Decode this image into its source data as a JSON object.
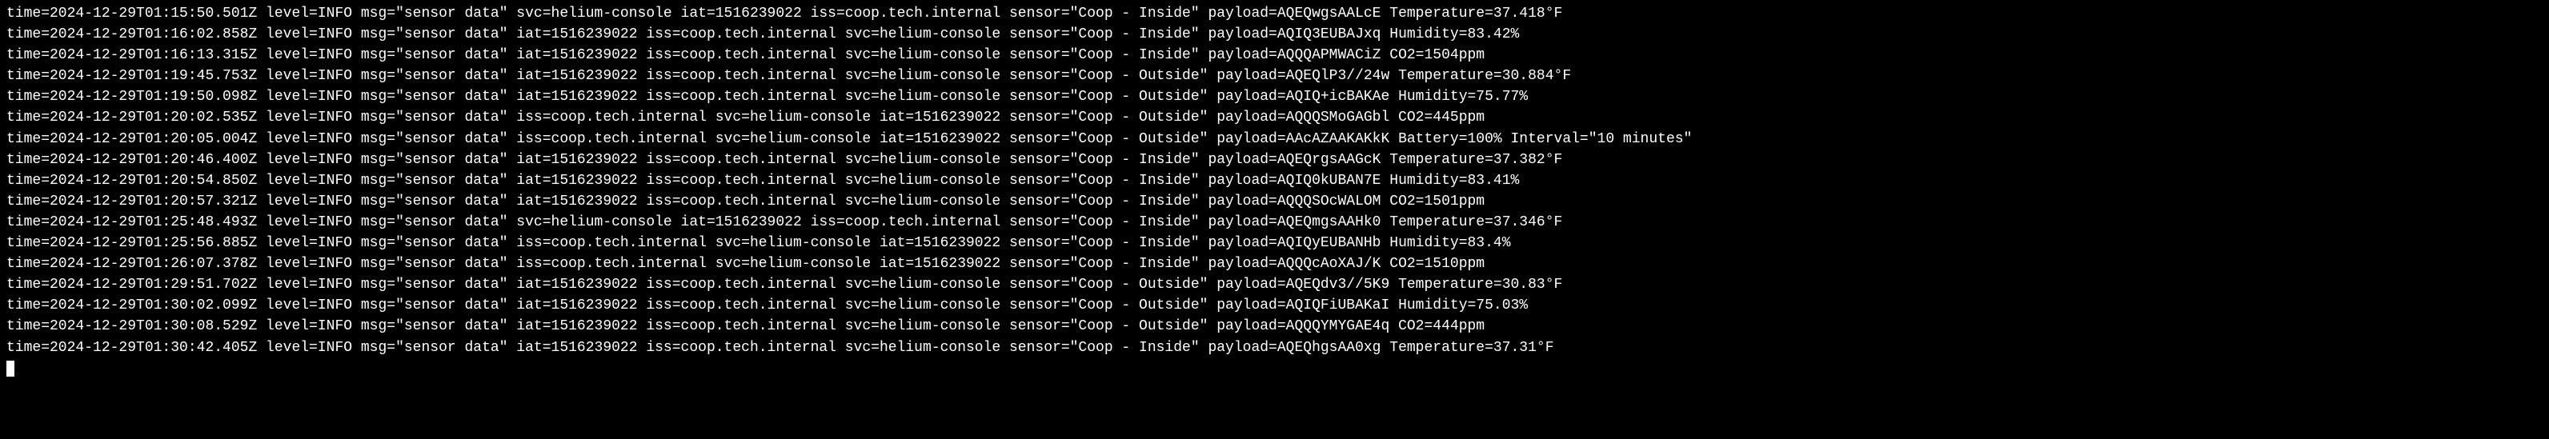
{
  "logs": [
    {
      "time": "2024-12-29T01:15:50.501Z",
      "level": "INFO",
      "msg": "sensor data",
      "fields": [
        [
          "svc",
          "helium-console"
        ],
        [
          "iat",
          "1516239022"
        ],
        [
          "iss",
          "coop.tech.internal"
        ]
      ],
      "sensor": "Coop - Inside",
      "payload": "AQEQwgsAALcE",
      "measurement": "Temperature=37.418°F"
    },
    {
      "time": "2024-12-29T01:16:02.858Z",
      "level": "INFO",
      "msg": "sensor data",
      "fields": [
        [
          "iat",
          "1516239022"
        ],
        [
          "iss",
          "coop.tech.internal"
        ],
        [
          "svc",
          "helium-console"
        ]
      ],
      "sensor": "Coop - Inside",
      "payload": "AQIQ3EUBAJxq",
      "measurement": "Humidity=83.42%"
    },
    {
      "time": "2024-12-29T01:16:13.315Z",
      "level": "INFO",
      "msg": "sensor data",
      "fields": [
        [
          "iat",
          "1516239022"
        ],
        [
          "iss",
          "coop.tech.internal"
        ],
        [
          "svc",
          "helium-console"
        ]
      ],
      "sensor": "Coop - Inside",
      "payload": "AQQQAPMWACiZ",
      "measurement": "CO2=1504ppm"
    },
    {
      "time": "2024-12-29T01:19:45.753Z",
      "level": "INFO",
      "msg": "sensor data",
      "fields": [
        [
          "iat",
          "1516239022"
        ],
        [
          "iss",
          "coop.tech.internal"
        ],
        [
          "svc",
          "helium-console"
        ]
      ],
      "sensor": "Coop - Outside",
      "payload": "AQEQlP3//24w",
      "measurement": "Temperature=30.884°F"
    },
    {
      "time": "2024-12-29T01:19:50.098Z",
      "level": "INFO",
      "msg": "sensor data",
      "fields": [
        [
          "iat",
          "1516239022"
        ],
        [
          "iss",
          "coop.tech.internal"
        ],
        [
          "svc",
          "helium-console"
        ]
      ],
      "sensor": "Coop - Outside",
      "payload": "AQIQ+icBAKAe",
      "measurement": "Humidity=75.77%"
    },
    {
      "time": "2024-12-29T01:20:02.535Z",
      "level": "INFO",
      "msg": "sensor data",
      "fields": [
        [
          "iss",
          "coop.tech.internal"
        ],
        [
          "svc",
          "helium-console"
        ],
        [
          "iat",
          "1516239022"
        ]
      ],
      "sensor": "Coop - Outside",
      "payload": "AQQQSMoGAGbl",
      "measurement": "CO2=445ppm"
    },
    {
      "time": "2024-12-29T01:20:05.004Z",
      "level": "INFO",
      "msg": "sensor data",
      "fields": [
        [
          "iss",
          "coop.tech.internal"
        ],
        [
          "svc",
          "helium-console"
        ],
        [
          "iat",
          "1516239022"
        ]
      ],
      "sensor": "Coop - Outside",
      "payload": "AAcAZAAKAKkK",
      "measurement": "Battery=100% Interval=\"10 minutes\""
    },
    {
      "time": "2024-12-29T01:20:46.400Z",
      "level": "INFO",
      "msg": "sensor data",
      "fields": [
        [
          "iat",
          "1516239022"
        ],
        [
          "iss",
          "coop.tech.internal"
        ],
        [
          "svc",
          "helium-console"
        ]
      ],
      "sensor": "Coop - Inside",
      "payload": "AQEQrgsAAGcK",
      "measurement": "Temperature=37.382°F"
    },
    {
      "time": "2024-12-29T01:20:54.850Z",
      "level": "INFO",
      "msg": "sensor data",
      "fields": [
        [
          "iat",
          "1516239022"
        ],
        [
          "iss",
          "coop.tech.internal"
        ],
        [
          "svc",
          "helium-console"
        ]
      ],
      "sensor": "Coop - Inside",
      "payload": "AQIQ0kUBAN7E",
      "measurement": "Humidity=83.41%"
    },
    {
      "time": "2024-12-29T01:20:57.321Z",
      "level": "INFO",
      "msg": "sensor data",
      "fields": [
        [
          "iat",
          "1516239022"
        ],
        [
          "iss",
          "coop.tech.internal"
        ],
        [
          "svc",
          "helium-console"
        ]
      ],
      "sensor": "Coop - Inside",
      "payload": "AQQQSOcWALOM",
      "measurement": "CO2=1501ppm"
    },
    {
      "time": "2024-12-29T01:25:48.493Z",
      "level": "INFO",
      "msg": "sensor data",
      "fields": [
        [
          "svc",
          "helium-console"
        ],
        [
          "iat",
          "1516239022"
        ],
        [
          "iss",
          "coop.tech.internal"
        ]
      ],
      "sensor": "Coop - Inside",
      "payload": "AQEQmgsAAHk0",
      "measurement": "Temperature=37.346°F"
    },
    {
      "time": "2024-12-29T01:25:56.885Z",
      "level": "INFO",
      "msg": "sensor data",
      "fields": [
        [
          "iss",
          "coop.tech.internal"
        ],
        [
          "svc",
          "helium-console"
        ],
        [
          "iat",
          "1516239022"
        ]
      ],
      "sensor": "Coop - Inside",
      "payload": "AQIQyEUBANHb",
      "measurement": "Humidity=83.4%"
    },
    {
      "time": "2024-12-29T01:26:07.378Z",
      "level": "INFO",
      "msg": "sensor data",
      "fields": [
        [
          "iss",
          "coop.tech.internal"
        ],
        [
          "svc",
          "helium-console"
        ],
        [
          "iat",
          "1516239022"
        ]
      ],
      "sensor": "Coop - Inside",
      "payload": "AQQQcAoXAJ/K",
      "measurement": "CO2=1510ppm"
    },
    {
      "time": "2024-12-29T01:29:51.702Z",
      "level": "INFO",
      "msg": "sensor data",
      "fields": [
        [
          "iat",
          "1516239022"
        ],
        [
          "iss",
          "coop.tech.internal"
        ],
        [
          "svc",
          "helium-console"
        ]
      ],
      "sensor": "Coop - Outside",
      "payload": "AQEQdv3//5K9",
      "measurement": "Temperature=30.83°F"
    },
    {
      "time": "2024-12-29T01:30:02.099Z",
      "level": "INFO",
      "msg": "sensor data",
      "fields": [
        [
          "iat",
          "1516239022"
        ],
        [
          "iss",
          "coop.tech.internal"
        ],
        [
          "svc",
          "helium-console"
        ]
      ],
      "sensor": "Coop - Outside",
      "payload": "AQIQFiUBAKaI",
      "measurement": "Humidity=75.03%"
    },
    {
      "time": "2024-12-29T01:30:08.529Z",
      "level": "INFO",
      "msg": "sensor data",
      "fields": [
        [
          "iat",
          "1516239022"
        ],
        [
          "iss",
          "coop.tech.internal"
        ],
        [
          "svc",
          "helium-console"
        ]
      ],
      "sensor": "Coop - Outside",
      "payload": "AQQQYMYGAE4q",
      "measurement": "CO2=444ppm"
    },
    {
      "time": "2024-12-29T01:30:42.405Z",
      "level": "INFO",
      "msg": "sensor data",
      "fields": [
        [
          "iat",
          "1516239022"
        ],
        [
          "iss",
          "coop.tech.internal"
        ],
        [
          "svc",
          "helium-console"
        ]
      ],
      "sensor": "Coop - Inside",
      "payload": "AQEQhgsAA0xg",
      "measurement": "Temperature=37.31°F"
    }
  ]
}
